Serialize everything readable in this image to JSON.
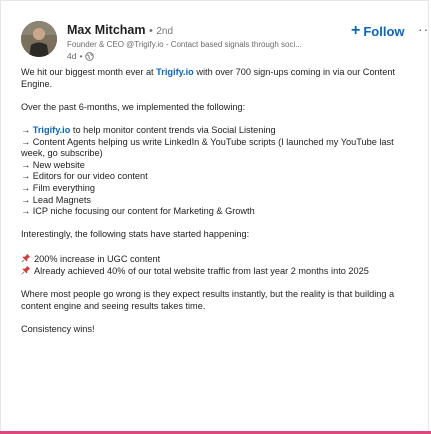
{
  "author": {
    "name": "Max Mitcham",
    "separator": "•",
    "degree": "2nd",
    "headline": "Founder & CEO @Trigify.io - Contact based signals through soci...",
    "age": "4d",
    "age_separator": "•"
  },
  "actions": {
    "follow_plus": "+",
    "follow_label": "Follow",
    "more_label": "···"
  },
  "post": {
    "line1_pre": "We hit our biggest month ever at ",
    "line1_link": "Trigify.io",
    "line1_post": " with over 700 sign-ups coming in via our Content Engine.",
    "intro": "Over the past 6-months, we implemented the following:",
    "item1_arrow": "→ ",
    "item1_link": "Trigify.io",
    "item1_text": " to help monitor content trends via Social Listening",
    "items": [
      "→ Content Agents helping us write LinkedIn & YouTube scripts (I launched my YouTube last week, go subscribe)",
      "→ New website",
      "→ Editors for our video content",
      "→ Film everything",
      "→ Lead Magnets",
      "→ ICP niche focusing our content for Marketing & Growth"
    ],
    "stats_intro": "Interestingly, the following stats have started happening:",
    "stats": [
      "200% increase in UGC content",
      "Already achieved 40% of our total website traffic from last year 2 months into 2025"
    ],
    "closing": "Where most people go wrong is they expect results instantly, but the reality is that building a content engine and seeing results takes time.",
    "signoff": "Consistency wins!"
  },
  "colors": {
    "link": "#0a66c2",
    "accent_bar": "#e0457b"
  }
}
